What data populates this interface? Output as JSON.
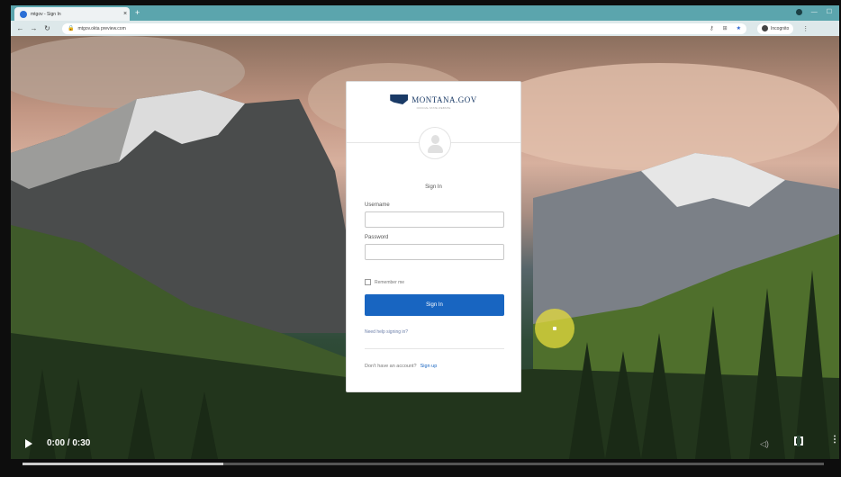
{
  "browser": {
    "tab_title": "mtgov - Sign In",
    "tab_close": "×",
    "new_tab": "+",
    "url": "mtgov.okta preview.com",
    "incognito_label": "Incognito",
    "win_controls": [
      "—",
      "☐"
    ]
  },
  "login": {
    "logo_text": "MONTANA.GOV",
    "logo_sub": "OFFICIAL STATE WEBSITE",
    "title": "Sign In",
    "username_label": "Username",
    "username_value": "",
    "password_label": "Password",
    "password_value": "",
    "remember_label": "Remember me",
    "signin_button": "Sign In",
    "help_link": "Need help signing in?",
    "no_account_text": "Don't have an account?",
    "signup_link": "Sign up"
  },
  "video": {
    "time": "0:00 / 0:30",
    "progress": 0.25
  },
  "colors": {
    "accent": "#1865c1",
    "tabbar": "#5ba5ad",
    "cursor_highlight": "#e6dc3c"
  },
  "icons": [
    "favicon-icon",
    "back-icon",
    "forward-icon",
    "reload-icon",
    "lock-icon",
    "star-icon",
    "incognito-icon",
    "play-icon",
    "volume-icon",
    "fullscreen-icon",
    "more-icon"
  ]
}
